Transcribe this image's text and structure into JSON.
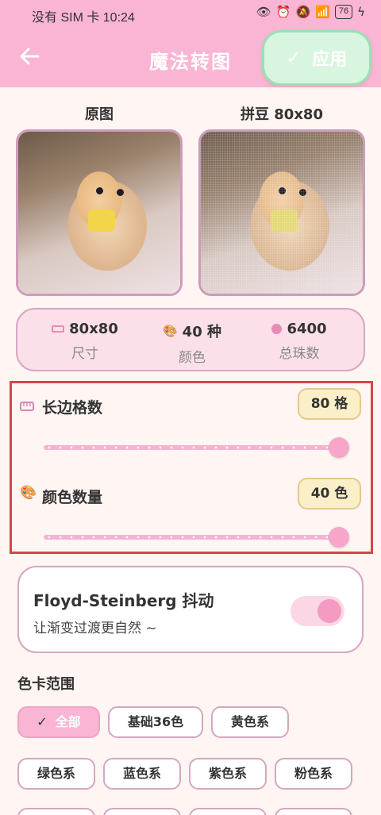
{
  "status_bar": {
    "left_text": "没有 SIM 卡 10:24",
    "battery": "76"
  },
  "header": {
    "title": "魔法转图",
    "apply_label": "应用"
  },
  "images": {
    "original_label": "原图",
    "bead_label": "拼豆 80x80"
  },
  "stats": {
    "size_value": "80x80",
    "size_label": "尺寸",
    "colors_value": "40 种",
    "colors_label": "颜色",
    "beads_value": "6400",
    "beads_label": "总珠数"
  },
  "sliders": {
    "long_side_label": "长边格数",
    "long_side_value": "80 格",
    "long_side_fraction": 1.0,
    "color_count_label": "颜色数量",
    "color_count_value": "40 色",
    "color_count_fraction": 1.0
  },
  "dither": {
    "title": "Floyd-Steinberg 抖动",
    "subtitle": "让渐变过渡更自然 ~",
    "enabled": true
  },
  "palette": {
    "title": "色卡范围",
    "chips_row1": [
      "全部",
      "基础36色",
      "黄色系"
    ],
    "chips_row2": [
      "绿色系",
      "蓝色系",
      "紫色系",
      "粉色系"
    ]
  },
  "colors": {
    "header_bg": "#f9b5d3",
    "apply_bg": "#d7f5df",
    "accent_pink": "#f7a6c9",
    "highlight_border": "#d9444e"
  }
}
